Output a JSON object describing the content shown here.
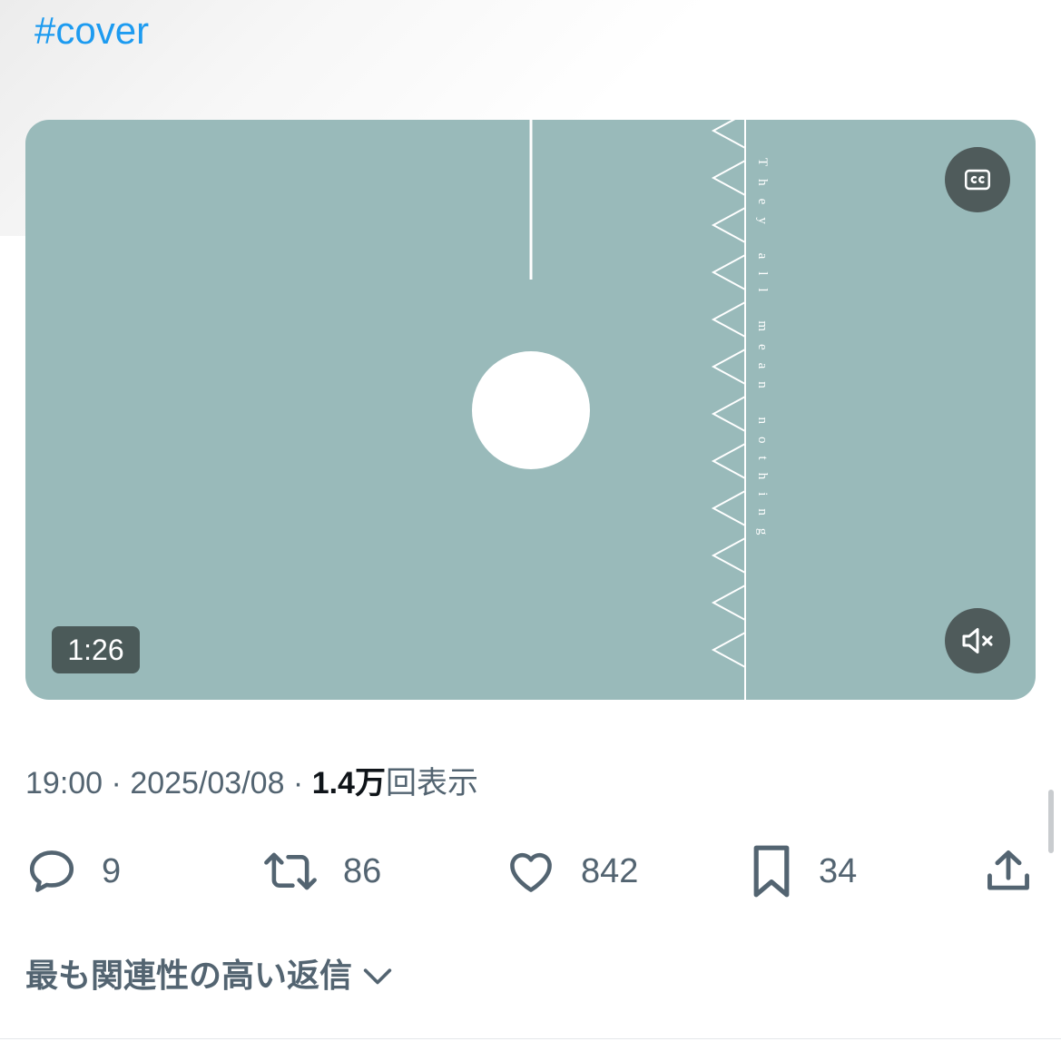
{
  "tweet": {
    "hashtag": "#cover",
    "video": {
      "overlay_text": "They all mean nothing",
      "duration": "1:26",
      "background_color": "#99baba",
      "cc_icon": "closed-captions-icon",
      "mute_icon": "speaker-muted-icon"
    },
    "meta": {
      "time": "19:00",
      "separator": " · ",
      "date": "2025/03/08",
      "views_count": "1.4万",
      "views_label": "回表示"
    },
    "actions": {
      "replies": {
        "icon": "reply-icon",
        "count": "9"
      },
      "retweets": {
        "icon": "retweet-icon",
        "count": "86"
      },
      "likes": {
        "icon": "heart-icon",
        "count": "842"
      },
      "bookmarks": {
        "icon": "bookmark-icon",
        "count": "34"
      },
      "share": {
        "icon": "share-icon"
      }
    },
    "replies_sort": {
      "label": "最も関連性の高い返信",
      "icon": "chevron-down-icon"
    }
  },
  "colors": {
    "accent": "#1d9bf0",
    "secondary_text": "#536471",
    "primary_text": "#0f1419"
  }
}
